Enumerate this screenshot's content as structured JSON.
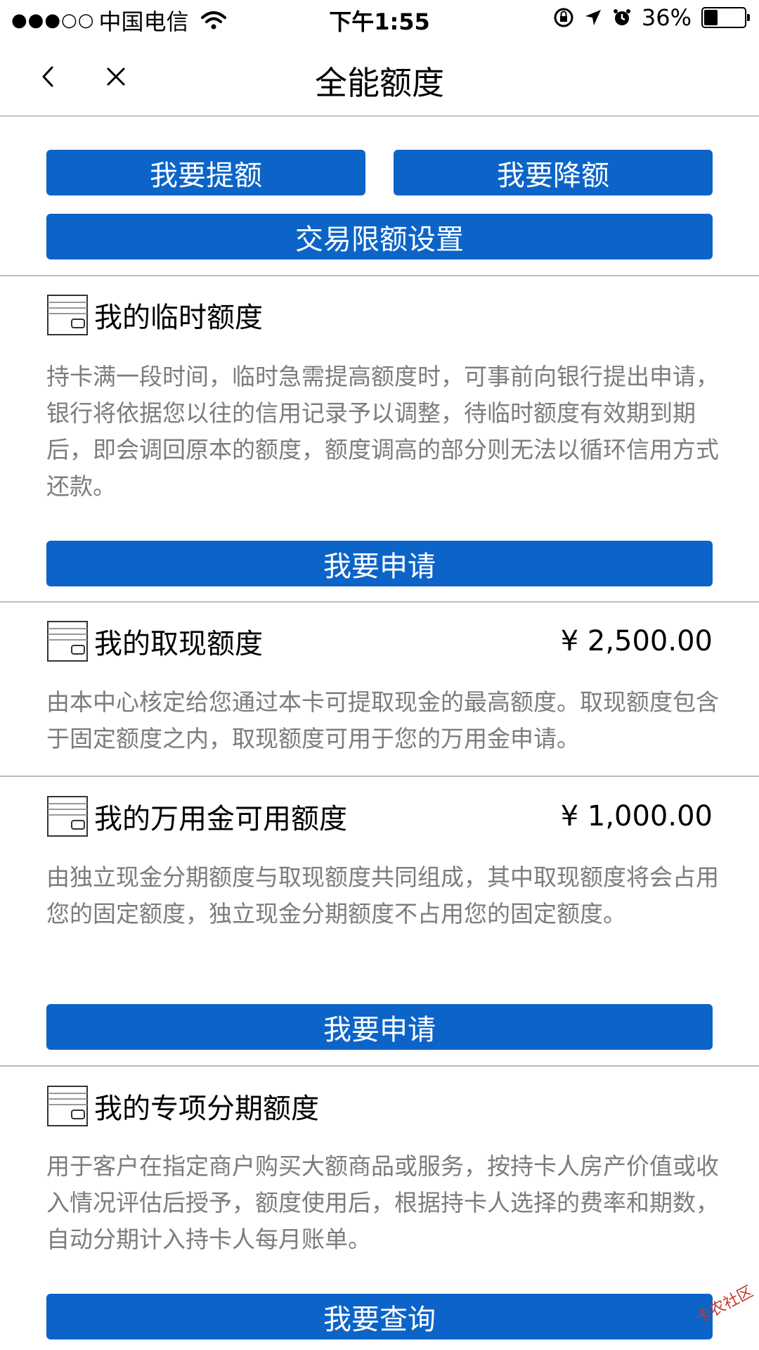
{
  "status_bar": {
    "signal_dots": "●●●○○",
    "carrier": "中国电信",
    "time": "下午1:55",
    "battery_percent": "36%",
    "battery_level": 0.36
  },
  "nav": {
    "title": "全能额度"
  },
  "actions": {
    "increase_label": "我要提额",
    "decrease_label": "我要降额",
    "limit_setting_label": "交易限额设置"
  },
  "sections": {
    "temporary": {
      "title": "我的临时额度",
      "description": "持卡满一段时间，临时急需提高额度时，可事前向银行提出申请，银行将依据您以往的信用记录予以调整，待临时额度有效期到期后，即会调回原本的额度，额度调高的部分则无法以循环信用方式还款。",
      "button_label": "我要申请"
    },
    "cash": {
      "title": "我的取现额度",
      "amount": "¥  2,500.00",
      "description": "由本中心核定给您通过本卡可提取现金的最高额度。取现额度包含于固定额度之内，取现额度可用于您的万用金申请。"
    },
    "wanyongjin": {
      "title": "我的万用金可用额度",
      "amount": "¥  1,000.00",
      "description": "由独立现金分期额度与取现额度共同组成，其中取现额度将会占用您的固定额度，独立现金分期额度不占用您的固定额度。",
      "button_label": "我要申请"
    },
    "special": {
      "title": "我的专项分期额度",
      "description": "用于客户在指定商户购买大额商品或服务，按持卡人房产价值或收入情况评估后授予，额度使用后，根据持卡人选择的费率和期数，自动分期计入持卡人每月账单。",
      "button_label": "我要查询"
    }
  },
  "watermark": "卡农社区",
  "colors": {
    "button_blue": "#0c64c8",
    "description_gray": "#7c7c7c",
    "divider_gray": "#bdbdbd"
  }
}
